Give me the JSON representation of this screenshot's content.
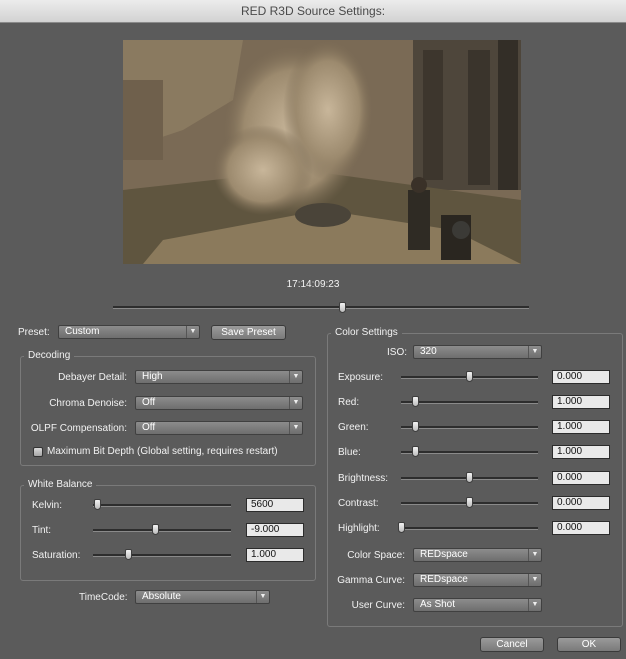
{
  "window": {
    "title": "RED R3D Source Settings:"
  },
  "preview": {
    "timecode": "17:14:09:23",
    "scrub_position": 0.55
  },
  "preset": {
    "label": "Preset:",
    "value": "Custom",
    "save_label": "Save Preset"
  },
  "decoding": {
    "title": "Decoding",
    "debayer_label": "Debayer Detail:",
    "debayer_value": "High",
    "chroma_label": "Chroma Denoise:",
    "chroma_value": "Off",
    "olpf_label": "OLPF Compensation:",
    "olpf_value": "Off",
    "maxbit_label": "Maximum Bit Depth (Global setting, requires restart)",
    "maxbit_checked": false
  },
  "white_balance": {
    "title": "White Balance",
    "kelvin_label": "Kelvin:",
    "kelvin_value": "5600",
    "tint_label": "Tint:",
    "tint_value": "-9.000",
    "saturation_label": "Saturation:",
    "saturation_value": "1.000"
  },
  "timecode": {
    "label": "TimeCode:",
    "value": "Absolute"
  },
  "color_settings": {
    "title": "Color Settings",
    "iso_label": "ISO:",
    "iso_value": "320",
    "exposure_label": "Exposure:",
    "exposure_value": "0.000",
    "red_label": "Red:",
    "red_value": "1.000",
    "green_label": "Green:",
    "green_value": "1.000",
    "blue_label": "Blue:",
    "blue_value": "1.000",
    "brightness_label": "Brightness:",
    "brightness_value": "0.000",
    "contrast_label": "Contrast:",
    "contrast_value": "0.000",
    "highlight_label": "Highlight:",
    "highlight_value": "0.000",
    "color_space_label": "Color Space:",
    "color_space_value": "REDspace",
    "gamma_label": "Gamma Curve:",
    "gamma_value": "REDspace",
    "user_curve_label": "User Curve:",
    "user_curve_value": "As Shot"
  },
  "footer": {
    "cancel_label": "Cancel",
    "ok_label": "OK"
  },
  "icons": {
    "dropdown_arrow": "chevron-down-icon"
  },
  "colors": {
    "panel_bg": "#5b5b5b",
    "field_bg": "#e9e9e9"
  }
}
